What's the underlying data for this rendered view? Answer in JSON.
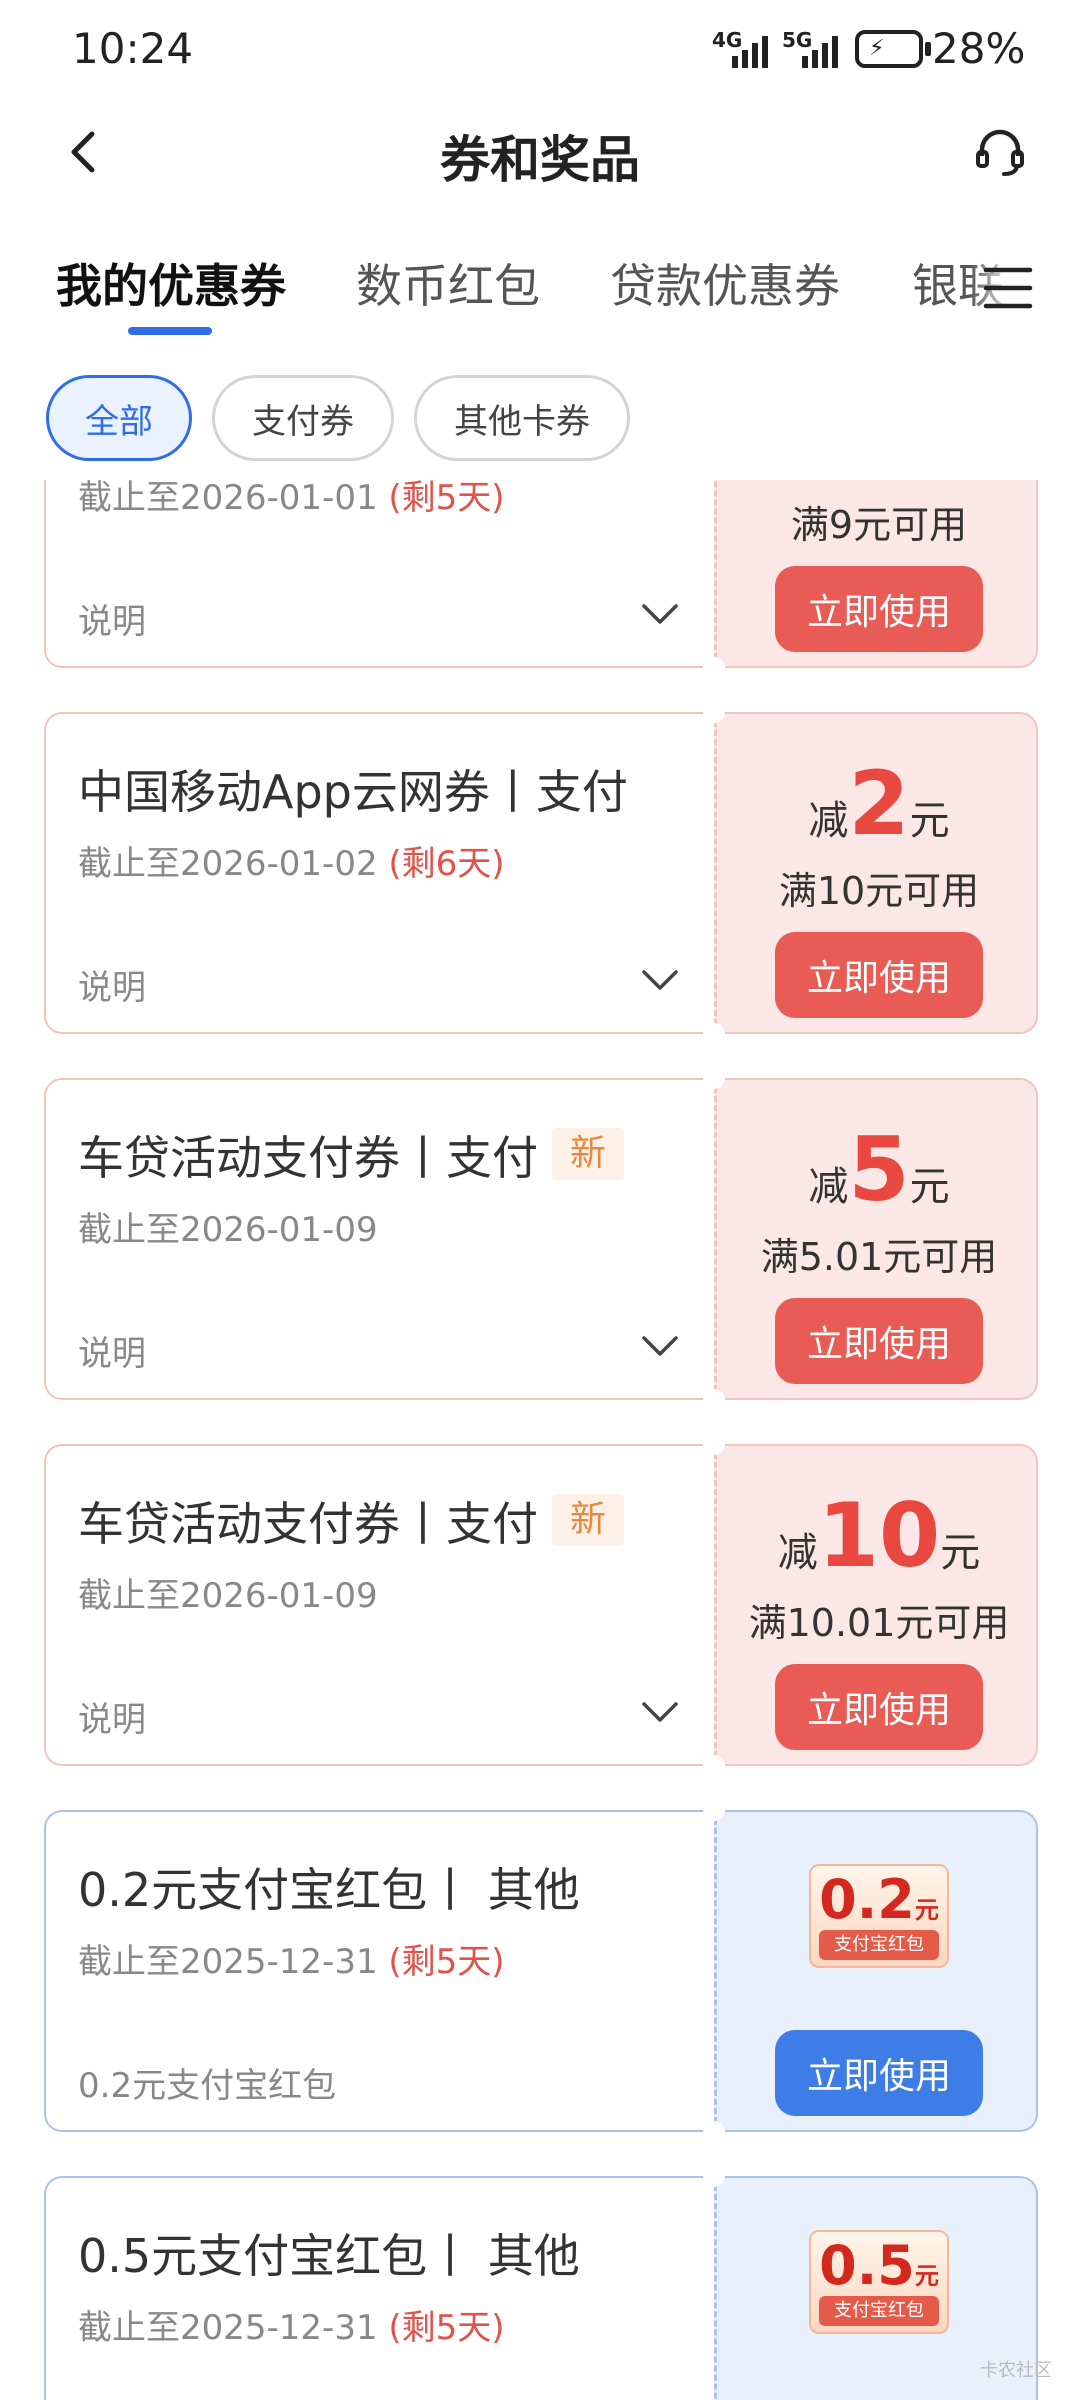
{
  "status_bar": {
    "time": "10:24",
    "network_1": "4G",
    "network_2": "5G",
    "battery_percent": "28%"
  },
  "header": {
    "title": "券和奖品",
    "back_icon": "back-arrow-icon",
    "support_icon": "headset-icon"
  },
  "tabs": [
    {
      "label": "我的优惠券",
      "active": true
    },
    {
      "label": "数币红包",
      "active": false
    },
    {
      "label": "贷款优惠券",
      "active": false
    },
    {
      "label": "银联",
      "active": false
    }
  ],
  "filters": [
    {
      "label": "全部",
      "active": true
    },
    {
      "label": "支付券",
      "active": false
    },
    {
      "label": "其他卡券",
      "active": false
    }
  ],
  "coupons": [
    {
      "expiry": "截止至2026-01-01",
      "remaining": "(剩5天)",
      "desc": "说明",
      "condition": "满9元可用",
      "button": "立即使用"
    },
    {
      "name": "中国移动App云网券丨支付",
      "expiry": "截止至2026-01-02",
      "remaining": "(剩6天)",
      "desc": "说明",
      "prefix": "减",
      "amount": "2",
      "unit": "元",
      "condition": "满10元可用",
      "button": "立即使用"
    },
    {
      "name": "车贷活动支付券丨支付",
      "badge": "新",
      "expiry": "截止至2026-01-09",
      "desc": "说明",
      "prefix": "减",
      "amount": "5",
      "unit": "元",
      "condition": "满5.01元可用",
      "button": "立即使用"
    },
    {
      "name": "车贷活动支付券丨支付",
      "badge": "新",
      "expiry": "截止至2026-01-09",
      "desc": "说明",
      "prefix": "减",
      "amount": "10",
      "unit": "元",
      "condition": "满10.01元可用",
      "button": "立即使用"
    },
    {
      "name": "0.2元支付宝红包丨 其他",
      "expiry": "截止至2025-12-31",
      "remaining": "(剩5天)",
      "desc": "0.2元支付宝红包",
      "hongbao_value": "0.2",
      "hongbao_unit": "元",
      "hongbao_label": "支付宝红包",
      "button": "立即使用"
    },
    {
      "name": "0.5元支付宝红包丨 其他",
      "expiry": "截止至2025-12-31",
      "remaining": "(剩5天)",
      "hongbao_value": "0.5",
      "hongbao_unit": "元",
      "hongbao_label": "支付宝红包"
    }
  ],
  "watermark": "卡农社区",
  "colors": {
    "accent_blue": "#2f6ee6",
    "coupon_red": "#e8483f",
    "button_red": "#e85c55",
    "button_blue": "#3f7de6"
  }
}
